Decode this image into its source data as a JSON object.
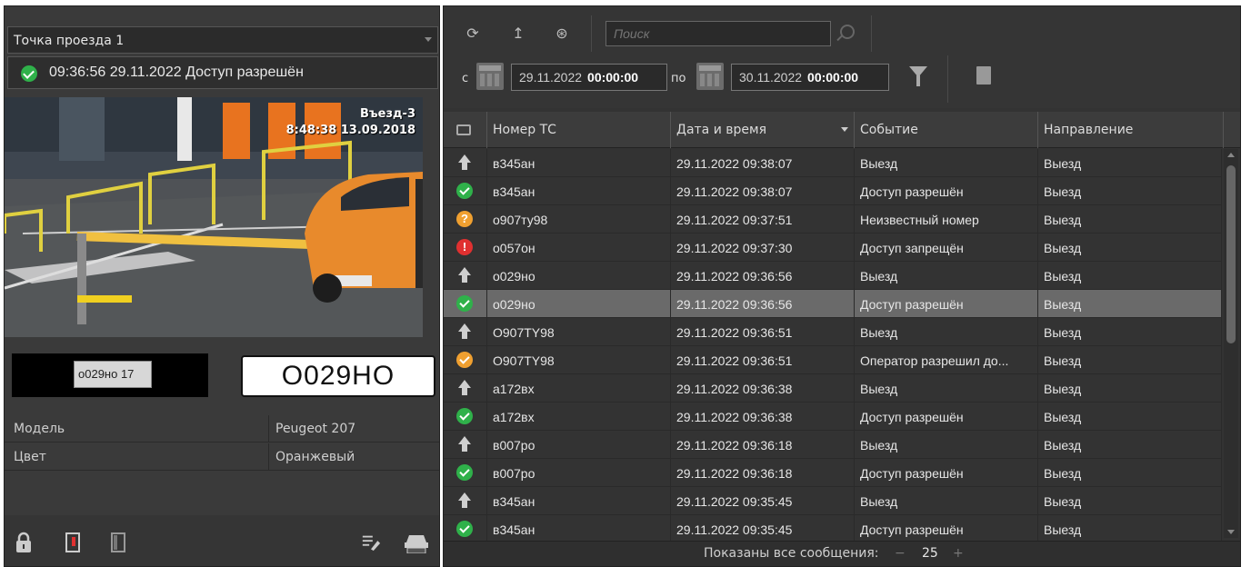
{
  "left_panel": {
    "checkpoint": "Точка проезда 1",
    "status": "09:36:56 29.11.2022 Доступ разрешён",
    "camera_overlay_line1": "Въезд-3",
    "camera_overlay_line2": "8:48:38 13.09.2018",
    "plate_crop_text": "о029но 17",
    "plate_recognized": "O029HO",
    "info": [
      {
        "key": "Модель",
        "value": "Peugeot 207"
      },
      {
        "key": "Цвет",
        "value": "Оранжевый"
      }
    ]
  },
  "toolbar": {
    "search_placeholder": "Поиск",
    "from_label": "с",
    "to_label": "по",
    "from_date": "29.11.2022",
    "from_time": "00:00:00",
    "to_date": "30.11.2022",
    "to_time": "00:00:00"
  },
  "table": {
    "columns": [
      "Номер ТС",
      "Дата и время",
      "Событие",
      "Направление"
    ],
    "rows": [
      {
        "icon": "arrow-up",
        "plate": "в345ан",
        "datetime": "29.11.2022 09:38:07",
        "event": "Выезд",
        "direction": "Выезд"
      },
      {
        "icon": "ok",
        "plate": "в345ан",
        "datetime": "29.11.2022 09:38:07",
        "event": "Доступ разрешён",
        "direction": "Выезд"
      },
      {
        "icon": "question",
        "plate": "о907ту98",
        "datetime": "29.11.2022 09:37:51",
        "event": "Неизвестный номер",
        "direction": "Выезд"
      },
      {
        "icon": "error",
        "plate": "о057он",
        "datetime": "29.11.2022 09:37:30",
        "event": "Доступ запрещён",
        "direction": "Выезд"
      },
      {
        "icon": "arrow-up",
        "plate": "о029но",
        "datetime": "29.11.2022 09:36:56",
        "event": "Выезд",
        "direction": "Выезд"
      },
      {
        "icon": "ok",
        "plate": "о029но",
        "datetime": "29.11.2022 09:36:56",
        "event": "Доступ разрешён",
        "direction": "Выезд",
        "selected": true
      },
      {
        "icon": "arrow-up",
        "plate": "О907ТY98",
        "datetime": "29.11.2022 09:36:51",
        "event": "Выезд",
        "direction": "Выезд"
      },
      {
        "icon": "operator-ok",
        "plate": "О907ТY98",
        "datetime": "29.11.2022 09:36:51",
        "event": "Оператор разрешил до...",
        "direction": "Выезд"
      },
      {
        "icon": "arrow-up",
        "plate": "а172вх",
        "datetime": "29.11.2022 09:36:38",
        "event": "Выезд",
        "direction": "Выезд"
      },
      {
        "icon": "ok",
        "plate": "а172вх",
        "datetime": "29.11.2022 09:36:38",
        "event": "Доступ разрешён",
        "direction": "Выезд"
      },
      {
        "icon": "arrow-up",
        "plate": "в007ро",
        "datetime": "29.11.2022 09:36:18",
        "event": "Выезд",
        "direction": "Выезд"
      },
      {
        "icon": "ok",
        "plate": "в007ро",
        "datetime": "29.11.2022 09:36:18",
        "event": "Доступ разрешён",
        "direction": "Выезд"
      },
      {
        "icon": "arrow-up",
        "plate": "в345ан",
        "datetime": "29.11.2022 09:35:45",
        "event": "Выезд",
        "direction": "Выезд"
      },
      {
        "icon": "ok",
        "plate": "в345ан",
        "datetime": "29.11.2022 09:35:45",
        "event": "Доступ разрешён",
        "direction": "Выезд"
      }
    ]
  },
  "footer": {
    "label": "Показаны все сообщения:",
    "count": "25",
    "minus": "−",
    "plus": "+"
  }
}
